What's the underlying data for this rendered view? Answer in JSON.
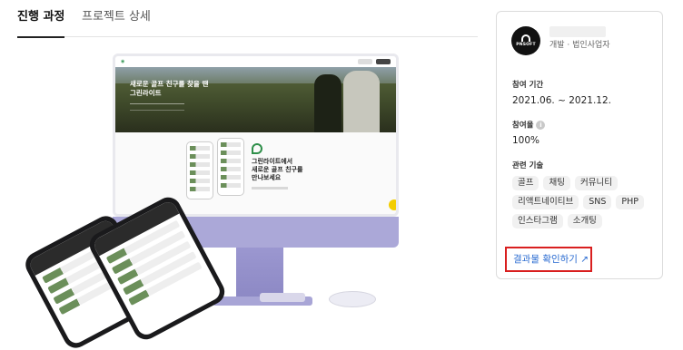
{
  "tabs": [
    {
      "label": "진행 과정",
      "active": true
    },
    {
      "label": "프로젝트 상세",
      "active": false
    }
  ],
  "mockup": {
    "hero_title": "새로운 골프 친구를 찾을 땐\n그린라이트",
    "lower_title": "그린라이트에서\n새로운 골프 친구를\n만나보세요"
  },
  "company": {
    "logo_text": "PNSOFT",
    "subtitle": "개발 · 법인사업자"
  },
  "period": {
    "label": "참여 기간",
    "value": "2021.06. ~ 2021.12."
  },
  "participation": {
    "label": "참여율",
    "info_icon": "i",
    "value": "100%"
  },
  "tech": {
    "label": "관련 기술",
    "tags": [
      "골프",
      "채팅",
      "커뮤니티",
      "리액트네이티브",
      "SNS",
      "PHP",
      "인스타그램",
      "소개팅"
    ]
  },
  "result_link": {
    "label": "결과물 확인하기 ↗"
  },
  "colors": {
    "accent_link": "#2a6bd1",
    "highlight_border": "#d91f1f",
    "monitor_purple": "#aba8d8",
    "brand_green": "#2f8f4a"
  }
}
